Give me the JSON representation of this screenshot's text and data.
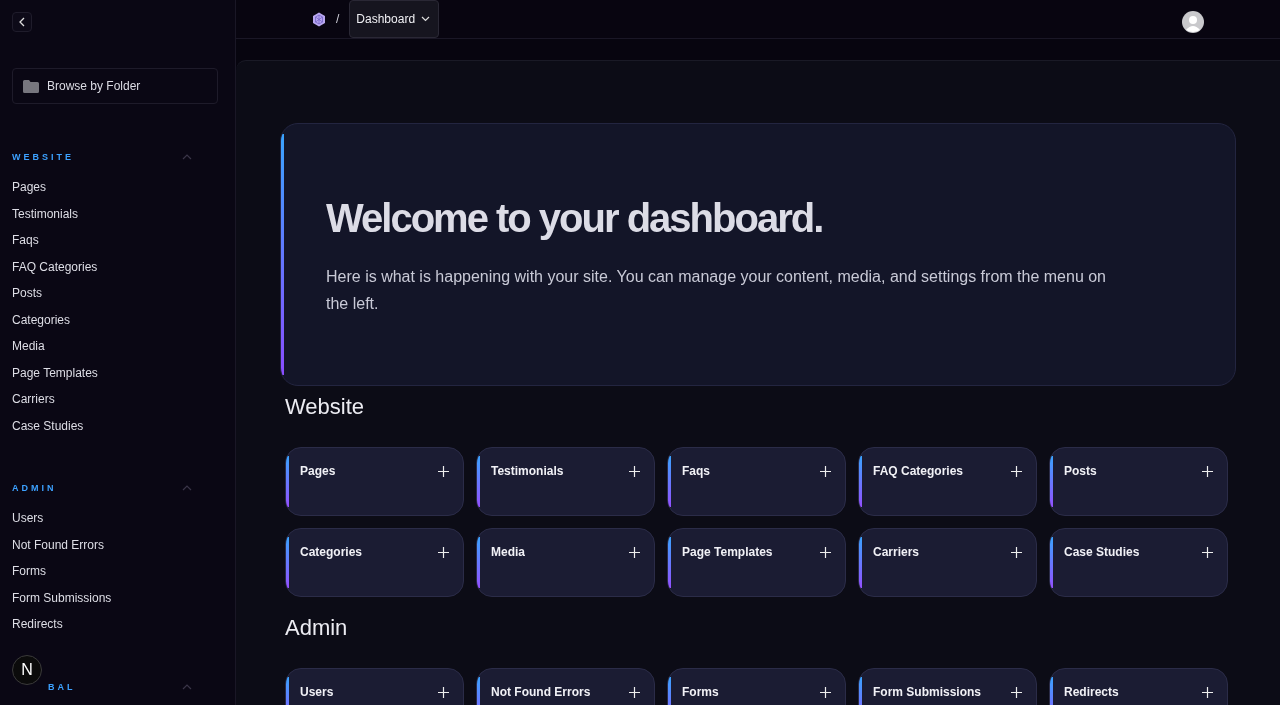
{
  "breadcrumb": {
    "separator": "/",
    "current": "Dashboard"
  },
  "sidebar": {
    "browse_button": "Browse by Folder",
    "groups": [
      {
        "heading": "WEBSITE",
        "expanded": true,
        "items": [
          "Pages",
          "Testimonials",
          "Faqs",
          "FAQ Categories",
          "Posts",
          "Categories",
          "Media",
          "Page Templates",
          "Carriers",
          "Case Studies"
        ]
      },
      {
        "heading": "ADMIN",
        "expanded": true,
        "items": [
          "Users",
          "Not Found Errors",
          "Forms",
          "Form Submissions",
          "Redirects"
        ]
      },
      {
        "heading": "BAL",
        "expanded": true
      }
    ]
  },
  "dev_badge": "N",
  "hero": {
    "title": "Welcome to your dashboard.",
    "text": "Here is what is happening with your site. You can manage your content, media, and settings from the menu on the left."
  },
  "sections": [
    {
      "title": "Website",
      "cards": [
        "Pages",
        "Testimonials",
        "Faqs",
        "FAQ Categories",
        "Posts",
        "Categories",
        "Media",
        "Page Templates",
        "Carriers",
        "Case Studies"
      ]
    },
    {
      "title": "Admin",
      "cards": [
        "Users",
        "Not Found Errors",
        "Forms",
        "Form Submissions",
        "Redirects"
      ]
    }
  ]
}
